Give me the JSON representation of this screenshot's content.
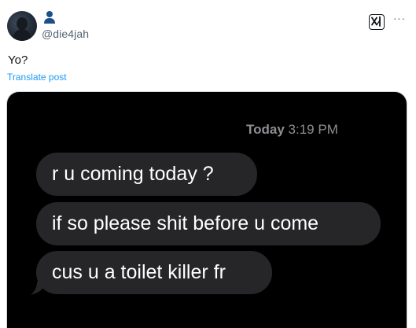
{
  "post": {
    "handle": "@die4jah",
    "text": "Yo?",
    "translate_label": "Translate post",
    "more_label": "···"
  },
  "media": {
    "timestamp_day": "Today",
    "timestamp_time": "3:19 PM",
    "messages": [
      "r u coming today ?",
      "if so please shit before u come",
      "cus u a toilet killer fr"
    ]
  },
  "colors": {
    "link": "#1d9bf0",
    "secondary_text": "#536471",
    "bubble": "#262628",
    "media_bg": "#000000"
  },
  "icons": {
    "avatar": "avatar-image",
    "name": "person-icon",
    "grok": "grok-icon",
    "more": "more-icon"
  }
}
